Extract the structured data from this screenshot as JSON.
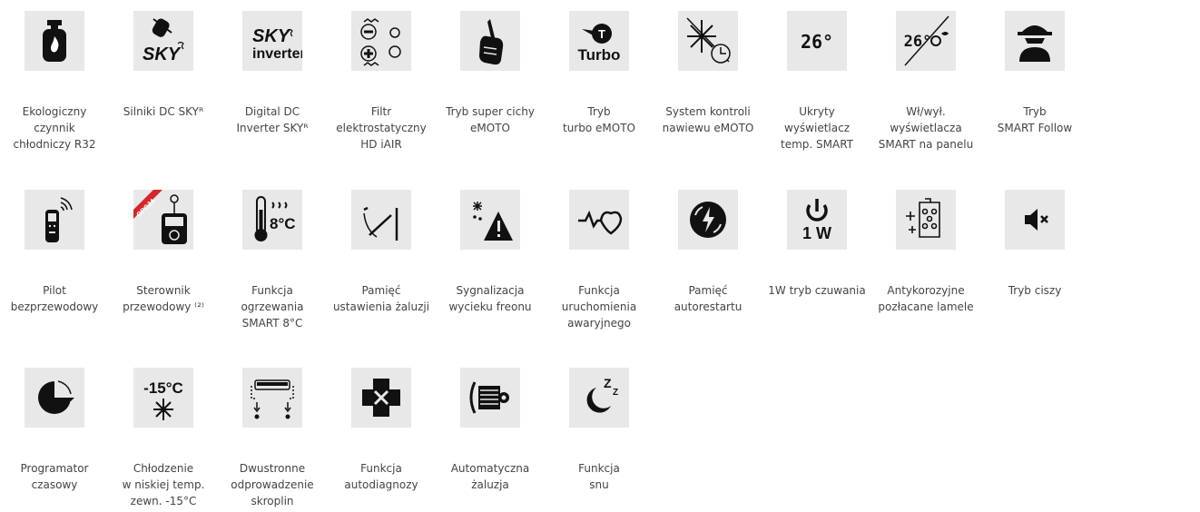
{
  "features": [
    {
      "icon": "gas-cylinder-flame-icon",
      "label": "Ekologiczny\nczynnik\nchłodniczy R32"
    },
    {
      "icon": "sky-dc-motor-icon",
      "label": "Silniki DC SKYᴿ",
      "text": "SKY"
    },
    {
      "icon": "sky-inverter-icon",
      "label": "Digital DC\nInverter SKYᴿ",
      "text": "SKY",
      "text2": "inverter"
    },
    {
      "icon": "electrostatic-filter-icon",
      "label": "Filtr\nelektrostatyczny\nHD iAIR"
    },
    {
      "icon": "silent-mode-hand-icon",
      "label": "Tryb super cichy\neMOTO"
    },
    {
      "icon": "turbo-icon",
      "label": "Tryb\nturbo eMOTO",
      "text": "Turbo",
      "badge": "T"
    },
    {
      "icon": "snowflake-timer-icon",
      "label": "System kontroli\nnawiewu eMOTO"
    },
    {
      "icon": "temperature-display-icon",
      "label": "Ukryty\nwyświetlacz\ntemp. SMART",
      "text": "26°"
    },
    {
      "icon": "display-off-icon",
      "label": "Wł/wył.\nwyświetlacza\nSMART na panelu",
      "text": "26°"
    },
    {
      "icon": "follow-me-spy-icon",
      "label": "Tryb\nSMART Follow"
    },
    {
      "icon": "wireless-remote-icon",
      "label": "Pilot\nbezprzewodowy"
    },
    {
      "icon": "wired-controller-icon",
      "label": "Sterownik\nprzewodowy ⁽²⁾",
      "badge": "OPCJA"
    },
    {
      "icon": "thermometer-8c-icon",
      "label": "Funkcja\nogrzewania\nSMART 8°C",
      "text": "8°C"
    },
    {
      "icon": "louver-memory-icon",
      "label": "Pamięć\nustawienia żaluzji"
    },
    {
      "icon": "refrigerant-leak-warning-icon",
      "label": "Sygnalizacja\nwycieku freonu"
    },
    {
      "icon": "heartbeat-icon",
      "label": "Funkcja\nuruchomienia\nawaryjnego"
    },
    {
      "icon": "auto-restart-icon",
      "label": "Pamięć\nautorestartu"
    },
    {
      "icon": "power-standby-icon",
      "label": "1W tryb czuwania",
      "text": "1 W"
    },
    {
      "icon": "gold-fin-icon",
      "label": "Antykorozyjne\npozłacane lamele"
    },
    {
      "icon": "mute-speaker-icon",
      "label": "Tryb ciszy"
    },
    {
      "icon": "timer-pie-icon",
      "label": "Programator\nczasowy"
    },
    {
      "icon": "low-temp-cooling-icon",
      "label": "Chłodzenie\nw niskiej temp.\nzewn. -15°C",
      "text": "-15°C"
    },
    {
      "icon": "dual-drain-icon",
      "label": "Dwustronne\nodprowadzenie\nskroplin"
    },
    {
      "icon": "self-diagnosis-icon",
      "label": "Funkcja\nautodiagnozy"
    },
    {
      "icon": "auto-louver-icon",
      "label": "Automatyczna\nżaluzja"
    },
    {
      "icon": "sleep-mode-icon",
      "label": "Funkcja\nsnu",
      "text": "Z"
    }
  ]
}
